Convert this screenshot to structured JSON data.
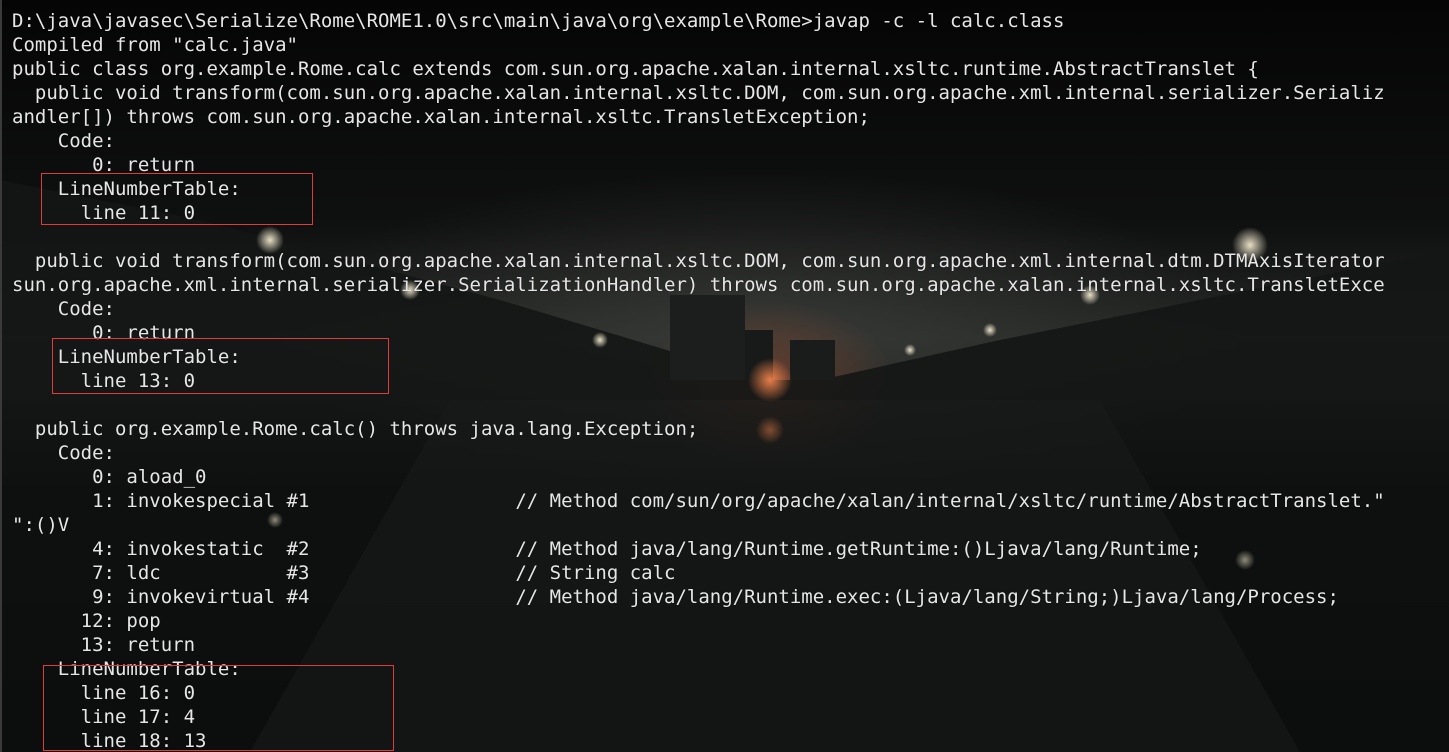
{
  "terminal": {
    "lines": [
      "D:\\java\\javasec\\Serialize\\Rome\\ROME1.0\\src\\main\\java\\org\\example\\Rome>javap -c -l calc.class",
      "Compiled from \"calc.java\"",
      "public class org.example.Rome.calc extends com.sun.org.apache.xalan.internal.xsltc.runtime.AbstractTranslet {",
      "  public void transform(com.sun.org.apache.xalan.internal.xsltc.DOM, com.sun.org.apache.xml.internal.serializer.Serializ",
      "andler[]) throws com.sun.org.apache.xalan.internal.xsltc.TransletException;",
      "    Code:",
      "       0: return",
      "    LineNumberTable:",
      "      line 11: 0",
      "",
      "  public void transform(com.sun.org.apache.xalan.internal.xsltc.DOM, com.sun.org.apache.xml.internal.dtm.DTMAxisIterator",
      "sun.org.apache.xml.internal.serializer.SerializationHandler) throws com.sun.org.apache.xalan.internal.xsltc.TransletExce",
      "    Code:",
      "       0: return",
      "    LineNumberTable:",
      "      line 13: 0",
      "",
      "  public org.example.Rome.calc() throws java.lang.Exception;",
      "    Code:",
      "       0: aload_0",
      "       1: invokespecial #1                  // Method com/sun/org/apache/xalan/internal/xsltc/runtime/AbstractTranslet.\"",
      "\":()V",
      "       4: invokestatic  #2                  // Method java/lang/Runtime.getRuntime:()Ljava/lang/Runtime;",
      "       7: ldc           #3                  // String calc",
      "       9: invokevirtual #4                  // Method java/lang/Runtime.exec:(Ljava/lang/String;)Ljava/lang/Process;",
      "      12: pop",
      "      13: return",
      "    LineNumberTable:",
      "      line 16: 0",
      "      line 17: 4",
      "      line 18: 13"
    ]
  }
}
